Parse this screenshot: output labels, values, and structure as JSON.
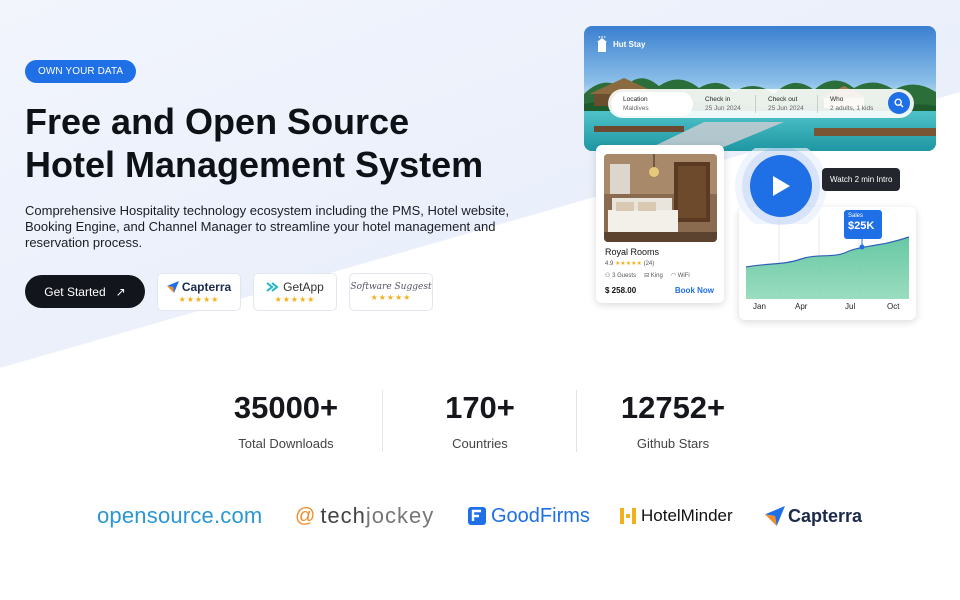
{
  "hero": {
    "badge": "OWN YOUR DATA",
    "title_line1": "Free and Open Source",
    "title_line2": "Hotel Management System",
    "subtitle": "Comprehensive Hospitality technology ecosystem including the PMS, Hotel website, Booking Engine, and Channel Manager to streamline your hotel management and reservation process.",
    "cta_label": "Get Started",
    "cta_icon": "arrow-up-right-icon"
  },
  "reviews": [
    {
      "name": "Capterra",
      "stars": "★★★★★"
    },
    {
      "name": "GetApp",
      "stars": "★★★★★"
    },
    {
      "name": "Software Suggest",
      "stars": "★★★★★"
    }
  ],
  "banner": {
    "brand": "Hut Stay",
    "search": {
      "location_label": "Location",
      "location_value": "Maldives",
      "checkin_label": "Check in",
      "checkin_value": "25 Jun 2024",
      "checkout_label": "Check out",
      "checkout_value": "25 Jun 2024",
      "who_label": "Who",
      "who_value": "2 adults, 1 kids"
    }
  },
  "room": {
    "name": "Royal Rooms",
    "rating": "4.9",
    "stars": "★★★★★",
    "reviews": "(24)",
    "amenities": [
      "3 Guests",
      "King",
      "WiFi"
    ],
    "price": "$ 258.00",
    "book_label": "Book Now"
  },
  "video": {
    "tip": "Watch 2 min Intro"
  },
  "sales": {
    "label": "Sales",
    "value": "$25K",
    "months": [
      "Jan",
      "Apr",
      "Jul",
      "Oct"
    ]
  },
  "stats": [
    {
      "value": "35000+",
      "label": "Total Downloads"
    },
    {
      "value": "170+",
      "label": "Countries"
    },
    {
      "value": "12752+",
      "label": "Github Stars"
    }
  ],
  "logos": {
    "opensource": "opensource.com",
    "techjockey_a": "tech",
    "techjockey_b": "jockey",
    "goodfirms": "GoodFirms",
    "hotelminder": "HotelMinder",
    "capterra": "Capterra"
  },
  "colors": {
    "accent": "#1f6fe6",
    "dark": "#12151c",
    "star": "#f2b01e"
  }
}
